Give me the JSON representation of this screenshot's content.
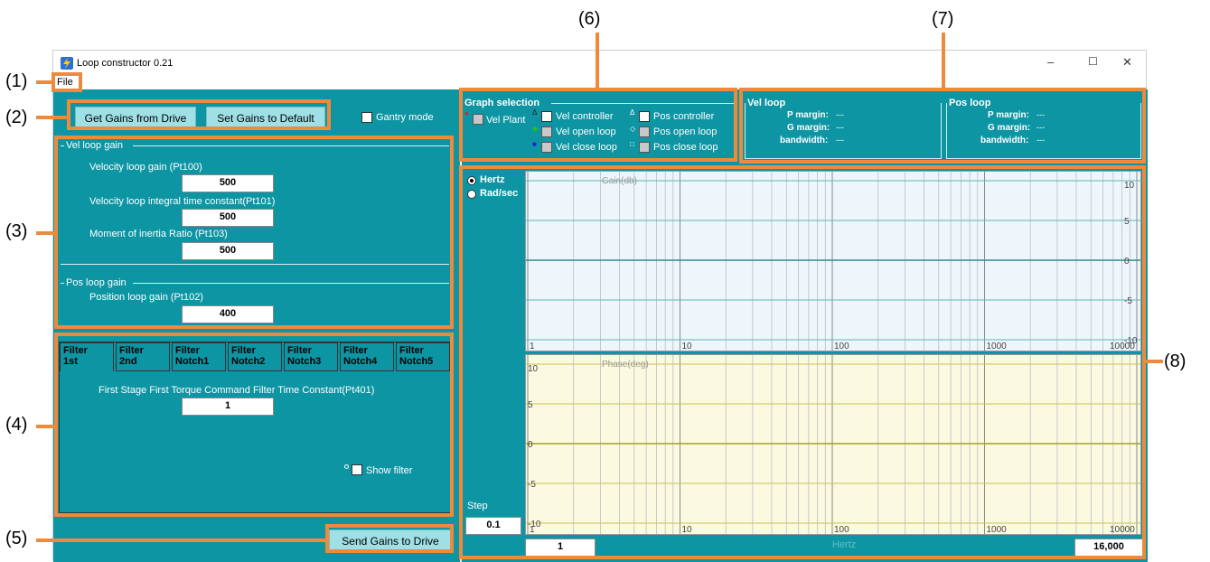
{
  "window": {
    "title": "Loop constructor 0.21",
    "minimize": "–",
    "maximize": "☐",
    "close": "✕"
  },
  "menu": {
    "file": "File"
  },
  "callouts": [
    "(1)",
    "(2)",
    "(3)",
    "(4)",
    "(5)",
    "(6)",
    "(7)",
    "(8)"
  ],
  "buttons": {
    "get_gains": "Get Gains from Drive",
    "set_default": "Set Gains to Default",
    "send_gains": "Send Gains to Drive"
  },
  "gantry": {
    "label": "Gantry mode",
    "checked": false
  },
  "vel_loop_gain": {
    "legend": "Vel loop gain",
    "params": [
      {
        "label": "Velocity loop gain (Pt100)",
        "value": "500"
      },
      {
        "label": "Velocity loop integral time constant(Pt101)",
        "value": "500"
      },
      {
        "label": "Moment of inertia Ratio (Pt103)",
        "value": "500"
      }
    ]
  },
  "pos_loop_gain": {
    "legend": "Pos loop gain",
    "params": [
      {
        "label": "Position loop gain (Pt102)",
        "value": "400"
      }
    ]
  },
  "filter_tabs": [
    "Filter\n1st",
    "Filter\n2nd",
    "Filter\nNotch1",
    "Filter\nNotch2",
    "Filter\nNotch3",
    "Filter\nNotch4",
    "Filter\nNotch5"
  ],
  "filter_tab_lines": [
    [
      "Filter",
      "1st"
    ],
    [
      "Filter",
      "2nd"
    ],
    [
      "Filter",
      "Notch1"
    ],
    [
      "Filter",
      "Notch2"
    ],
    [
      "Filter",
      "Notch3"
    ],
    [
      "Filter",
      "Notch4"
    ],
    [
      "Filter",
      "Notch5"
    ]
  ],
  "filter_param": {
    "label": "First Stage First Torque Command Filter Time Constant(Pt401)",
    "value": "1"
  },
  "show_filter": "Show filter",
  "graph_selection": {
    "legend": "Graph selection",
    "items": [
      {
        "label": "Vel Plant",
        "marker": "●",
        "marker_color": "#e02020"
      },
      {
        "label": "Vel controller",
        "marker": "Δ",
        "marker_color": "#222222"
      },
      {
        "label": "Vel open loop",
        "marker": "◆",
        "marker_color": "#20c020"
      },
      {
        "label": "Vel close loop",
        "marker": "■",
        "marker_color": "#2020e0"
      },
      {
        "label": "Pos controller",
        "marker": "Δ",
        "marker_color": "#ffffff"
      },
      {
        "label": "Pos open loop",
        "marker": "◇",
        "marker_color": "#ffffff"
      },
      {
        "label": "Pos close loop",
        "marker": "□",
        "marker_color": "#ffffff"
      }
    ]
  },
  "vel_loop": {
    "legend": "Vel loop",
    "p_margin": "P margin:",
    "g_margin": "G margin:",
    "bandwidth": "bandwidth:",
    "p_val": "---",
    "g_val": "---",
    "bw_val": "---"
  },
  "pos_loop": {
    "legend": "Pos loop",
    "p_margin": "P margin:",
    "g_margin": "G margin:",
    "bandwidth": "bandwidth:",
    "p_val": "---",
    "g_val": "---",
    "bw_val": "---"
  },
  "units": {
    "hertz": "Hertz",
    "radsec": "Rad/sec",
    "selected": "Hertz"
  },
  "step": {
    "label": "Step",
    "value": "0.1"
  },
  "range": {
    "min": "1",
    "max": "16,000",
    "unit": "Hertz"
  },
  "gain_plot": {
    "title": "Gain(db)",
    "y_ticks": [
      "10",
      "5",
      "0",
      "-5",
      "-10"
    ],
    "x_ticks": [
      "1",
      "10",
      "100",
      "1000",
      "10000"
    ]
  },
  "phase_plot": {
    "title": "Phase(deg)",
    "y_ticks": [
      "10",
      "5",
      "0",
      "-5",
      "-10"
    ],
    "x_ticks": [
      "1",
      "10",
      "100",
      "1000",
      "10000"
    ]
  }
}
